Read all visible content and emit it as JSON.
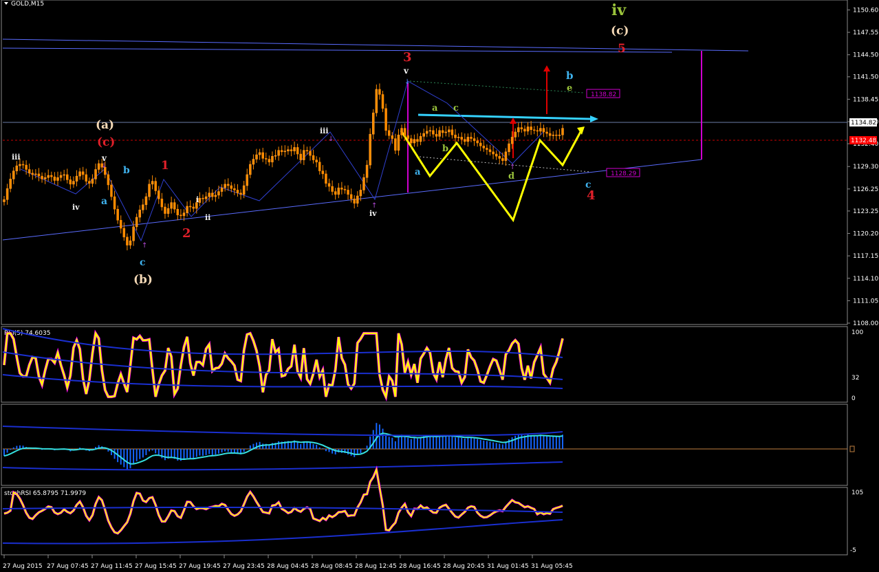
{
  "symbol": {
    "label": "GOLD,M15"
  },
  "colors": {
    "background": "#000000",
    "up_candle": "#ff8c00",
    "down_candle": "#ff8c00",
    "trendline": "#3a57d8",
    "channel": "#5a6cff",
    "yellow_path": "#ffff00",
    "cyan_line": "#35d2ff",
    "magenta": "#d000d0",
    "red_dashed": "#cc0000",
    "wave_red": "#e0202a",
    "wave_cyan": "#3fb3ef",
    "wave_green": "#9ac33b",
    "wave_white": "#f2f2f2",
    "wave_tan": "#f5d9b6",
    "price_label_current": "#ffffff",
    "price_label_red": "#ff0000"
  },
  "chart_data": [
    {
      "type": "line",
      "panel": "price",
      "title": "GOLD,M15",
      "ylim": [
        1108.0,
        1151.2
      ],
      "y_ticks": [
        "1150.60",
        "1147.55",
        "1144.50",
        "1141.50",
        "1138.45",
        "1135.40",
        "1132.40",
        "1129.30",
        "1126.25",
        "1123.25",
        "1120.20",
        "1117.15",
        "1114.10",
        "1111.05",
        "1108.00"
      ],
      "current_price": "1134.82",
      "red_level": "1132.48",
      "levels": [
        {
          "label": "1138.82",
          "value": 1138.82
        },
        {
          "label": "1128.29",
          "value": 1128.29
        }
      ],
      "x_labels": [
        "27 Aug 2015",
        "27 Aug 07:45",
        "27 Aug 11:45",
        "27 Aug 15:45",
        "27 Aug 19:45",
        "27 Aug 23:45",
        "28 Aug 04:45",
        "28 Aug 08:45",
        "28 Aug 12:45",
        "28 Aug 16:45",
        "28 Aug 20:45",
        "31 Aug 01:45",
        "31 Aug 05:45"
      ],
      "close_series": [
        1124.8,
        1126.3,
        1127.6,
        1128.7,
        1129.4,
        1129.6,
        1129.5,
        1128.9,
        1128.4,
        1128.2,
        1128.3,
        1128.0,
        1127.6,
        1127.8,
        1128.1,
        1127.9,
        1127.4,
        1127.8,
        1128.1,
        1128.2,
        1127.5,
        1126.9,
        1127.3,
        1128.0,
        1128.6,
        1128.2,
        1127.3,
        1127.0,
        1127.6,
        1128.9,
        1129.7,
        1129.2,
        1128.2,
        1126.8,
        1125.2,
        1123.5,
        1122.0,
        1120.9,
        1119.7,
        1118.6,
        1119.2,
        1121.1,
        1122.4,
        1123.4,
        1124.1,
        1125.2,
        1126.9,
        1127.3,
        1126.0,
        1124.9,
        1123.8,
        1122.9,
        1123.6,
        1124.4,
        1123.5,
        1122.7,
        1122.6,
        1123.0,
        1123.9,
        1123.8,
        1123.6,
        1124.4,
        1125.0,
        1124.9,
        1125.2,
        1125.7,
        1125.2,
        1125.4,
        1125.9,
        1126.4,
        1126.9,
        1126.7,
        1126.3,
        1126.1,
        1125.7,
        1125.5,
        1126.7,
        1128.2,
        1129.6,
        1130.3,
        1130.9,
        1131.2,
        1130.4,
        1130.3,
        1129.9,
        1130.7,
        1130.8,
        1131.5,
        1131.3,
        1131.4,
        1131.6,
        1131.4,
        1131.9,
        1131.0,
        1130.2,
        1131.5,
        1131.4,
        1130.8,
        1130.2,
        1129.9,
        1128.7,
        1128.3,
        1127.0,
        1126.6,
        1125.9,
        1125.5,
        1126.4,
        1126.2,
        1126.1,
        1125.5,
        1124.9,
        1124.3,
        1125.3,
        1126.1,
        1127.8,
        1129.5,
        1133.7,
        1136.6,
        1139.8,
        1139.1,
        1137.2,
        1134.2,
        1133.5,
        1133.1,
        1131.5,
        1133.6,
        1134.5,
        1133.5,
        1133.1,
        1132.5,
        1133.0,
        1132.7,
        1133.4,
        1133.8,
        1134.1,
        1134.2,
        1133.7,
        1133.4,
        1134.2,
        1133.9,
        1134.0,
        1134.3,
        1133.6,
        1133.2,
        1133.3,
        1133.0,
        1132.7,
        1133.3,
        1133.1,
        1132.8,
        1132.5,
        1132.1,
        1131.8,
        1131.6,
        1131.3,
        1131.0,
        1130.7,
        1130.4,
        1130.1,
        1131.3,
        1132.4,
        1133.3,
        1134.0,
        1134.6,
        1134.4,
        1134.1,
        1134.7,
        1134.3,
        1134.2,
        1134.1,
        1134.5,
        1134.0,
        1133.8,
        1133.5,
        1133.6,
        1133.5,
        1133.6,
        1134.5
      ],
      "waves": [
        {
          "text": "iii",
          "color": "wave_white",
          "x": 1127.0,
          "y": 1131.0
        },
        {
          "text": "iv",
          "color": "wave_white",
          "x": 1124.0,
          "y": 1124.0
        },
        {
          "text": "a",
          "color": "wave_cyan",
          "x": 1125.0,
          "y": 1125.0
        }
      ],
      "wave_labels": [
        "iv",
        "(c)",
        "5",
        "3",
        "v",
        "b",
        "e",
        "(a)",
        "(c)",
        "iii",
        "a",
        "c",
        "iii",
        "v",
        "b",
        "1",
        "a",
        "b",
        "i",
        "d",
        "iv",
        "ii",
        "2",
        "a",
        "iv",
        "c",
        "4",
        "c",
        "(b)"
      ]
    },
    {
      "type": "line",
      "panel": "rsi",
      "title": "RSI(5) 74.6035",
      "y_ticks": [
        "100",
        "32",
        "0"
      ],
      "ylim": [
        0,
        100
      ]
    },
    {
      "type": "area",
      "panel": "macd",
      "title": "",
      "zero_marker": "0"
    },
    {
      "type": "line",
      "panel": "stochrsi",
      "title": "stochRSI 65.8795 71.9979",
      "y_ticks": [
        "105",
        "-5"
      ]
    }
  ]
}
